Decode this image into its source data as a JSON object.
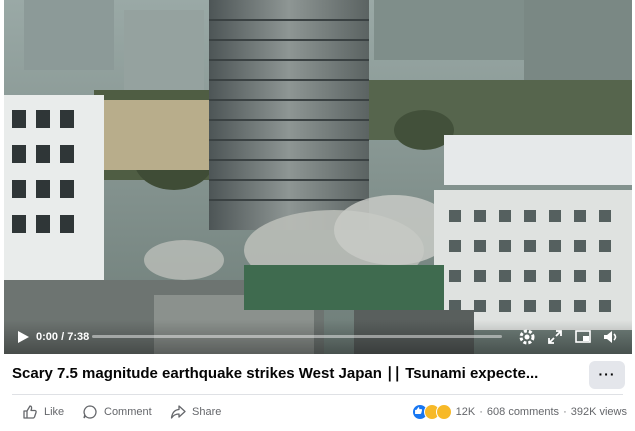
{
  "video": {
    "current_time": "0:00",
    "duration": "7:38",
    "time_separator": " / ",
    "progress": 0
  },
  "post": {
    "title": "Scary 7.5 magnitude earthquake strikes West Japan ∣∣ Tsunami expecte...",
    "more_label": "···"
  },
  "actions": {
    "like_label": "Like",
    "comment_label": "Comment",
    "share_label": "Share"
  },
  "stats": {
    "reactions_count": "12K",
    "comments": "608 comments",
    "separator": "·",
    "views": "392K views"
  },
  "colors": {
    "like_blue": "#1877f2",
    "haha_yellow": "#f7b928",
    "muted_text": "#65676b"
  }
}
